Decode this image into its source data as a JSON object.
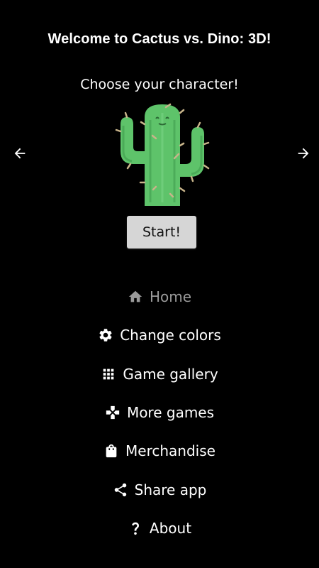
{
  "header": {
    "title": "Welcome to Cactus vs. Dino: 3D!",
    "subtitle": "Choose your character!"
  },
  "carousel": {
    "prev_icon": "arrow-left-icon",
    "next_icon": "arrow-right-icon",
    "character_icon": "cactus-icon"
  },
  "start_label": "Start!",
  "menu": {
    "items": [
      {
        "label": "Home",
        "icon": "home-icon",
        "active": false
      },
      {
        "label": "Change colors",
        "icon": "gear-icon"
      },
      {
        "label": "Game gallery",
        "icon": "grid-icon"
      },
      {
        "label": "More games",
        "icon": "gamepad-icon"
      },
      {
        "label": "Merchandise",
        "icon": "shopping-bag-icon"
      },
      {
        "label": "Share app",
        "icon": "share-icon"
      },
      {
        "label": "About",
        "icon": "question-icon"
      }
    ]
  },
  "colors": {
    "background": "#000000",
    "text": "#ffffff",
    "inactive_text": "#9a9a9a",
    "button_bg": "#d6d6d6",
    "cactus_green": "#5ec36a"
  }
}
